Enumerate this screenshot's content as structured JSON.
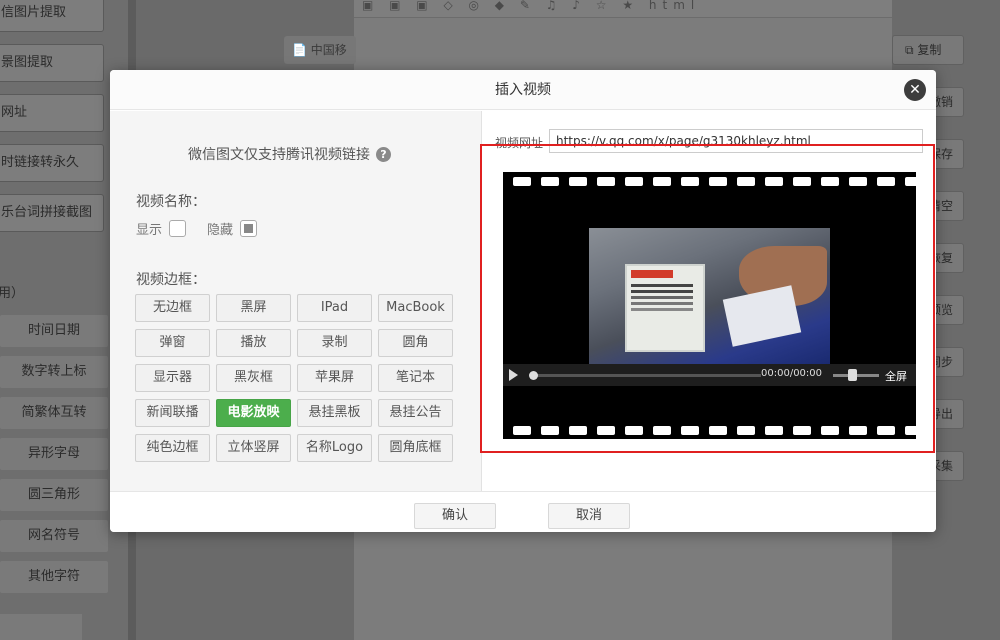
{
  "background": {
    "left_buttons": [
      "信图片提取",
      "景图提取",
      "网址",
      "时链接转永久",
      "乐台词拼接截图"
    ],
    "left_section": "用）",
    "left_items": [
      "时间日期",
      "数字转上标",
      "简繁体互转",
      "异形字母",
      "圆三角形",
      "网名符号",
      "其他字符"
    ],
    "toolbar_glyphs": "▣ ▣ ▣ ◇ ◎ ◆ ✎ ♫ ♪ ☆ ★  html",
    "doc_chip": "📄 中国移",
    "right_buttons": [
      "复制",
      "撤销",
      "保存",
      "清空",
      "恢复",
      "预览",
      "同步",
      "导出",
      "采集"
    ]
  },
  "modal": {
    "title": "插入视频",
    "close_label": "✕",
    "hint": "微信图文仅支持腾讯视频链接",
    "help_label": "?",
    "video_name_label": "视频名称：",
    "show_label": "显示",
    "hide_label": "隐藏",
    "hide_checked": true,
    "video_border_label": "视频边框：",
    "border_styles": [
      "无边框",
      "黑屏",
      "IPad",
      "MacBook",
      "弹窗",
      "播放",
      "录制",
      "圆角",
      "显示器",
      "黑灰框",
      "苹果屏",
      "笔记本",
      "新闻联播",
      "电影放映",
      "悬挂黑板",
      "悬挂公告",
      "纯色边框",
      "立体竖屏",
      "名称Logo",
      "圆角底框"
    ],
    "selected_style": "电影放映",
    "url_label": "视频网址",
    "url_value": "https://v.qq.com/x/page/g3130khleyz.html",
    "player": {
      "time": "00:00/00:00",
      "fullscreen_label": "全屏",
      "progress": 0
    },
    "confirm_label": "确认",
    "cancel_label": "取消"
  },
  "colors": {
    "accent_green": "#4cae4c",
    "highlight_red": "#e02020"
  }
}
